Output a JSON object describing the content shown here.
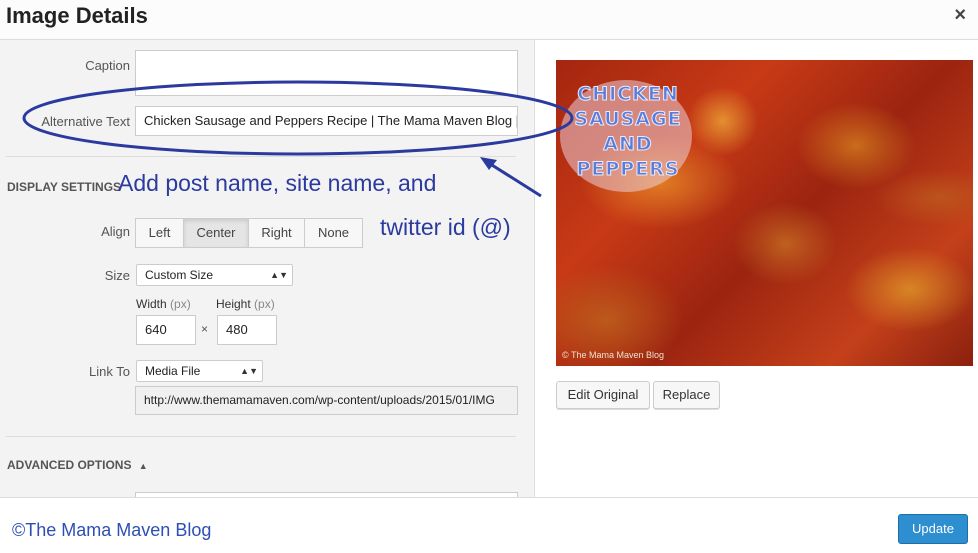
{
  "dialog": {
    "title": "Image Details",
    "close_label": "×"
  },
  "fields": {
    "caption_label": "Caption",
    "caption_value": "",
    "alt_label": "Alternative Text",
    "alt_value": "Chicken Sausage and Peppers Recipe | The Mama Maven Blog | @"
  },
  "display": {
    "section_title": "DISPLAY SETTINGS",
    "align_label": "Align",
    "align_options": [
      "Left",
      "Center",
      "Right",
      "None"
    ],
    "align_selected": "Center",
    "size_label": "Size",
    "size_value": "Custom Size",
    "width_label": "Width",
    "height_label": "Height",
    "unit": "(px)",
    "width_value": "640",
    "height_value": "480",
    "times": "×",
    "link_label": "Link To",
    "link_value": "Media File",
    "url_value": "http://www.themamamaven.com/wp-content/uploads/2015/01/IMG"
  },
  "advanced": {
    "title": "ADVANCED OPTIONS",
    "arrow": "▲"
  },
  "annotation": {
    "line1": "Add post name, site name, and",
    "line2": "twitter id (@)",
    "color": "#2b3a9e"
  },
  "image": {
    "overlay_lines": [
      "CHICKEN",
      "SAUSAGE",
      "AND",
      "PEPPERS"
    ],
    "watermark": "© The Mama Maven Blog"
  },
  "buttons": {
    "edit_original": "Edit Original",
    "replace": "Replace",
    "update": "Update"
  },
  "footer": {
    "copyright": "©The Mama Maven Blog"
  },
  "colors": {
    "accent": "#2e8fd0",
    "annotation": "#2b3a9e"
  }
}
